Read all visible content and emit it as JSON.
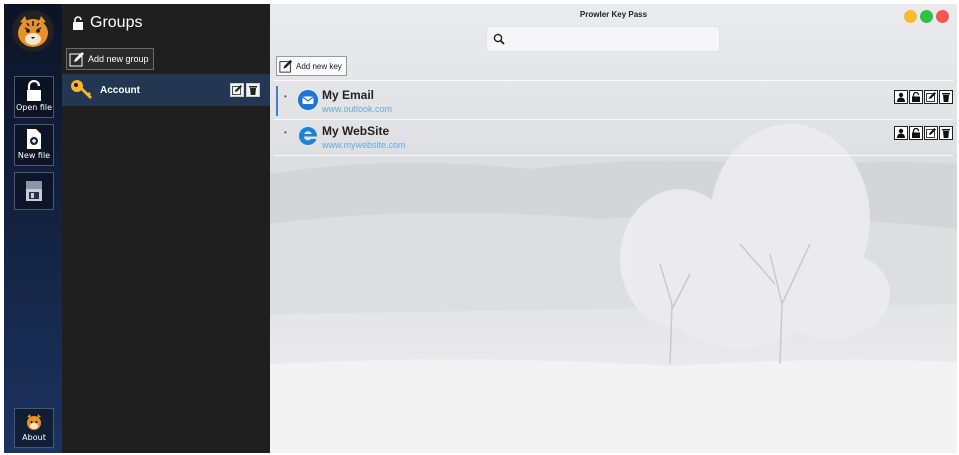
{
  "window": {
    "title": "Prowler Key Pass"
  },
  "rail": {
    "open_file_label": "Open file",
    "new_file_label": "New file",
    "about_label": "About"
  },
  "groups_panel": {
    "title": "Groups",
    "add_group_label": "Add new group",
    "items": [
      {
        "name": "Account"
      }
    ]
  },
  "toolbar": {
    "add_key_label": "Add new key",
    "search_placeholder": ""
  },
  "entries": [
    {
      "title": "My Email",
      "url": "www.outlook.com",
      "icon": "outlook-mail-icon"
    },
    {
      "title": "My WebSite",
      "url": "www.mywebsite.com",
      "icon": "edge-browser-icon"
    }
  ],
  "colors": {
    "traffic_minimize": "#f6be2f",
    "traffic_maximize": "#2fc33e",
    "traffic_close": "#f2584e",
    "accent": "#4a7bc8",
    "link": "#68a7d6"
  }
}
